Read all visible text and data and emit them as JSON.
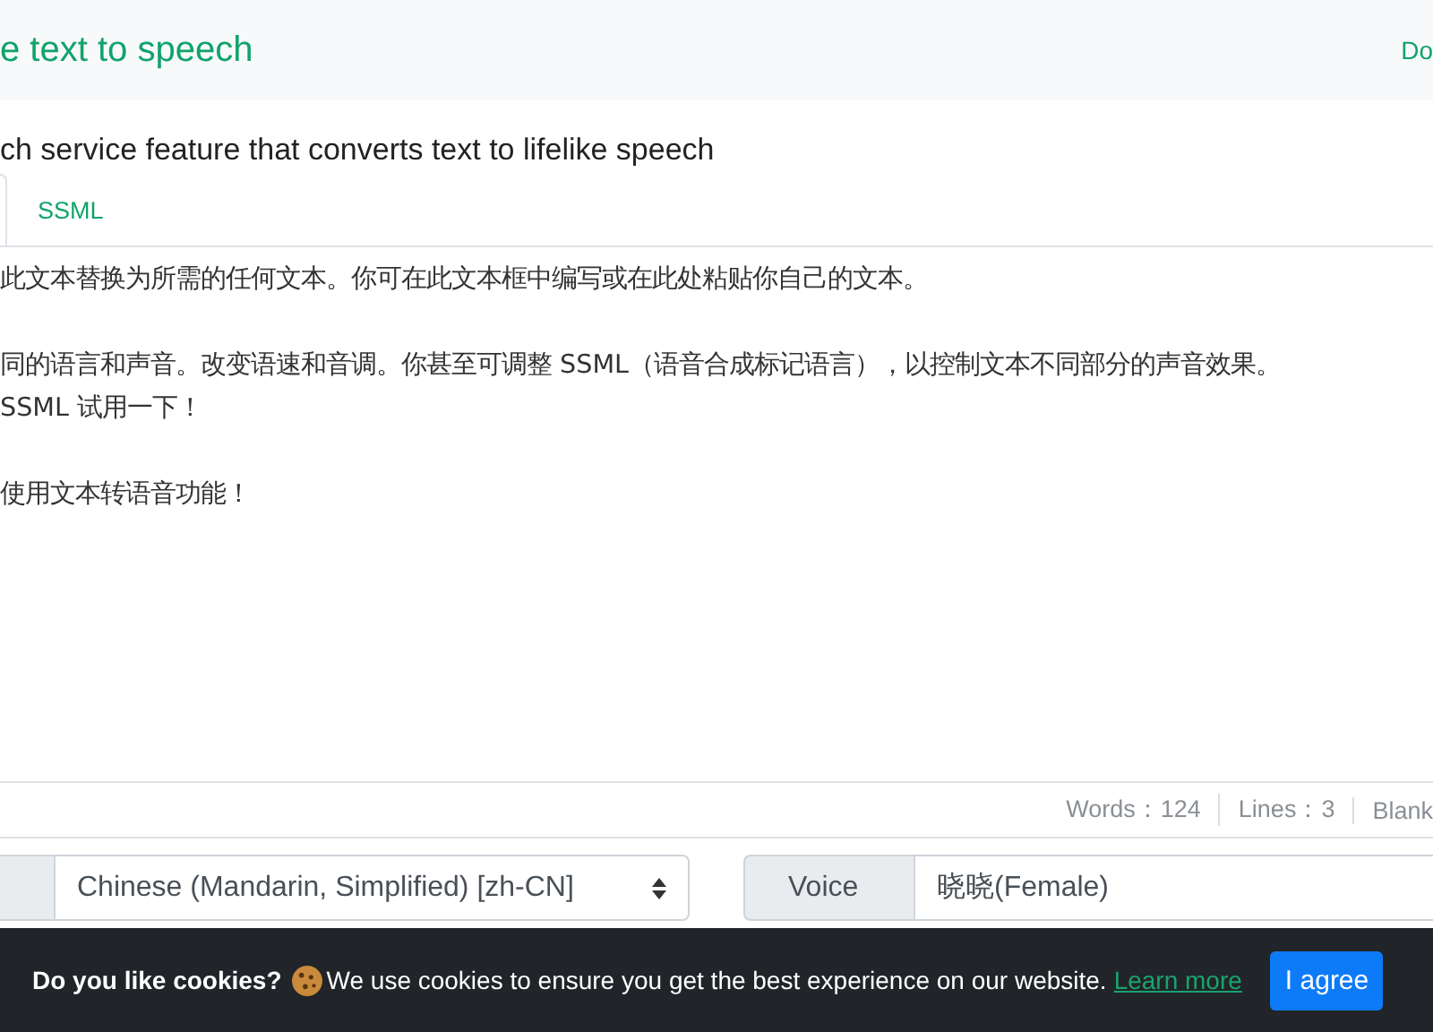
{
  "header": {
    "title": "e text to speech",
    "nav_link": "Do"
  },
  "subtitle": "ch service feature that converts text to lifelike speech",
  "tabs": [
    {
      "label": "SSML",
      "selected": false
    }
  ],
  "editor": {
    "paragraphs": [
      [
        "此文本替换为所需的任何文本。你可在此文本框中编写或在此处粘贴你自己的文本。"
      ],
      [
        "同的语言和声音。改变语速和音调。你甚至可调整 SSML（语音合成标记语言），以控制文本不同部分的声音效果。",
        "SSML 试用一下！"
      ],
      [
        "使用文本转语音功能！"
      ]
    ]
  },
  "stats": [
    {
      "label": "Words：124"
    },
    {
      "label": "Lines：3"
    },
    {
      "label": "Blank"
    }
  ],
  "language_select": {
    "value": "Chinese (Mandarin, Simplified) [zh-CN]"
  },
  "voice_select": {
    "label": "Voice",
    "value": "晓晓(Female)"
  },
  "cookie_bar": {
    "heading": "Do you like cookies?",
    "message": "We use cookies to ensure you get the best experience on our website.",
    "link": "Learn more",
    "button": "I agree"
  }
}
